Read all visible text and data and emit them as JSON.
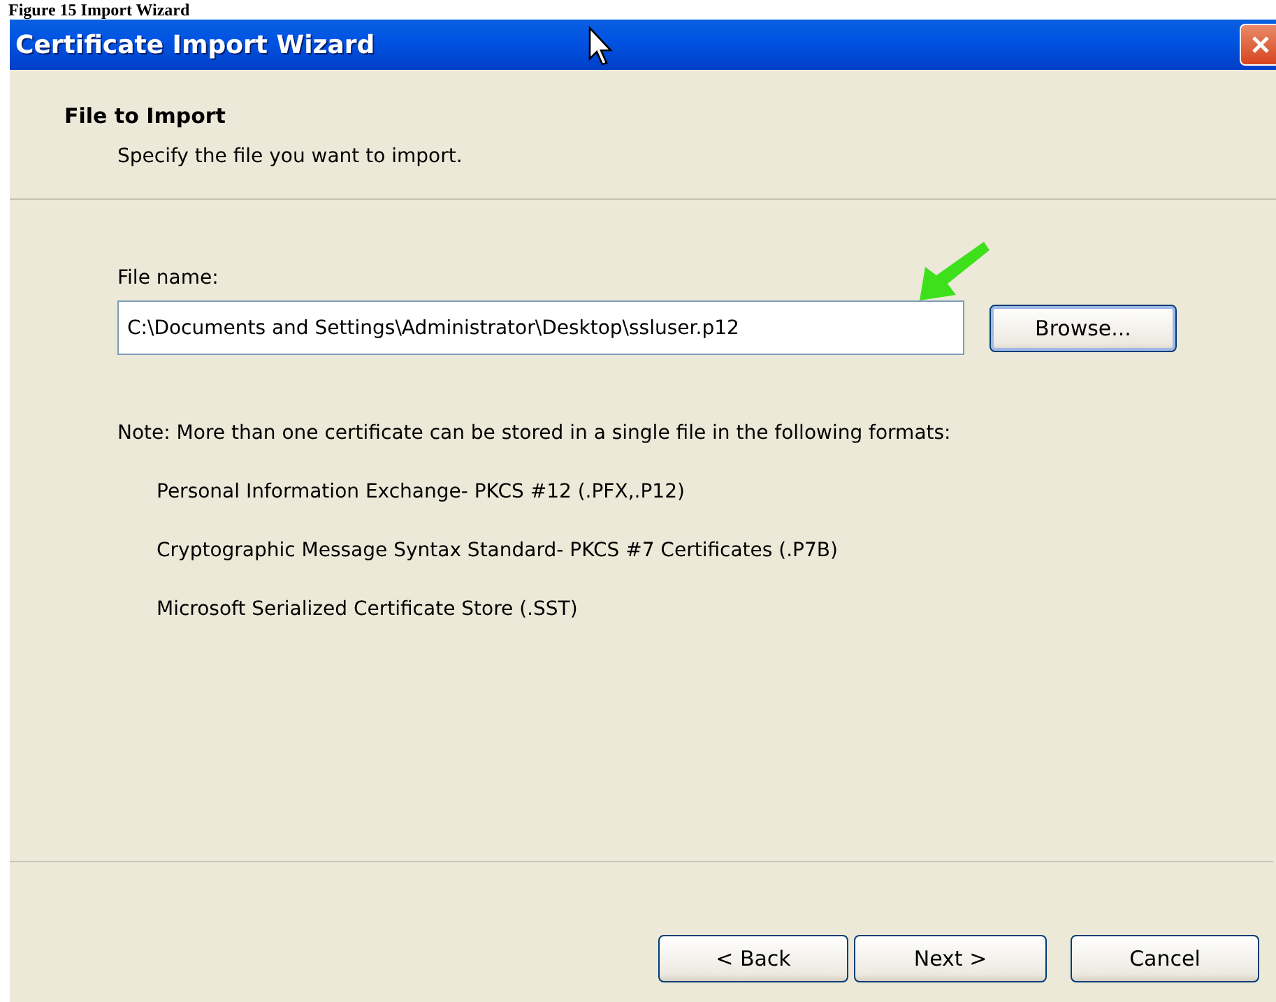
{
  "caption": "Figure 15 Import Wizard",
  "window": {
    "title": "Certificate Import Wizard"
  },
  "header": {
    "title": "File to Import",
    "subtitle": "Specify the file you want to import."
  },
  "file_field": {
    "label": "File name:",
    "value": "C:\\Documents and Settings\\Administrator\\Desktop\\ssluser.p12"
  },
  "browse_button": "Browse...",
  "note": "Note:  More than one certificate can be stored in a single file in the following formats:",
  "formats": [
    "Personal Information Exchange- PKCS #12 (.PFX,.P12)",
    "Cryptographic Message Syntax Standard- PKCS #7 Certificates (.P7B)",
    "Microsoft Serialized Certificate Store (.SST)"
  ],
  "buttons": [
    "< Back",
    "Next >",
    "Cancel"
  ]
}
